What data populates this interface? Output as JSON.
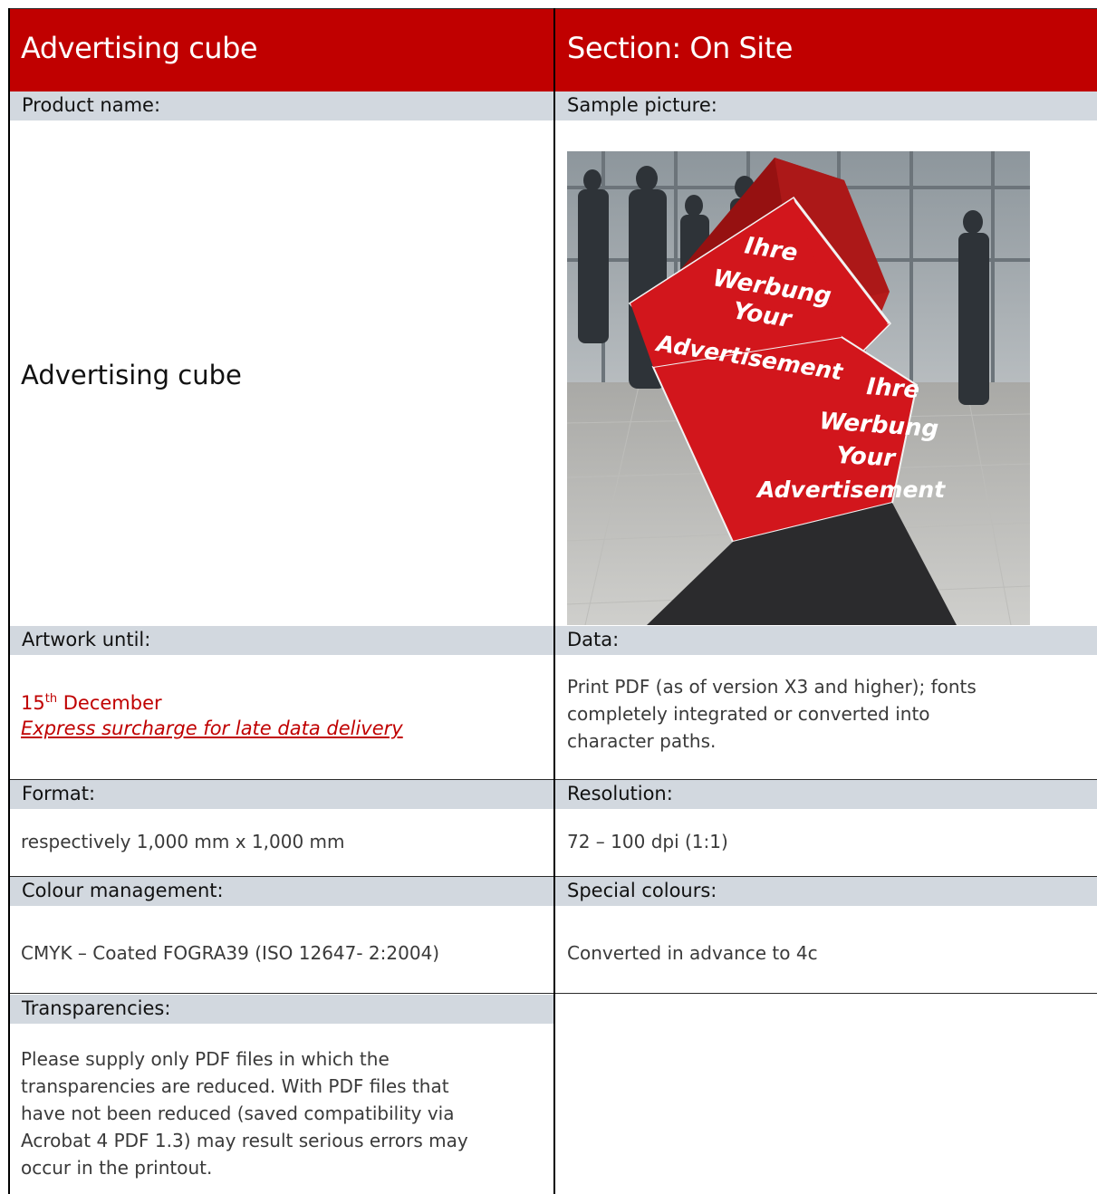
{
  "header": {
    "product_title": "Advertising cube",
    "section_title": "Section: On Site"
  },
  "product": {
    "label": "Product name:",
    "value": "Advertising cube"
  },
  "sample": {
    "label": "Sample picture:",
    "cube_top_text": [
      "Ihre",
      "Werbung",
      "Your",
      "Advertisement"
    ],
    "cube_bottom_text": [
      "Ihre",
      "Werbung",
      "Your",
      "Advertisement"
    ]
  },
  "artwork": {
    "label": "Artwork until:",
    "date_day": "15",
    "date_suffix": "th",
    "date_month": " December",
    "express_note": "Express surcharge for late data delivery"
  },
  "data": {
    "label": "Data:",
    "lines": [
      "Print PDF (as of version X3 and higher); fonts",
      "completely integrated or converted into",
      "character paths."
    ]
  },
  "format": {
    "label": "Format:",
    "value": "respectively 1,000 mm x 1,000 mm"
  },
  "resolution": {
    "label": "Resolution:",
    "value": "72 – 100 dpi (1:1)"
  },
  "colour_management": {
    "label": "Colour management:",
    "value": "CMYK – Coated FOGRA39 (ISO 12647- 2:2004)"
  },
  "special_colours": {
    "label": "Special colours:",
    "value": "Converted in advance to 4c"
  },
  "transparencies": {
    "label": "Transparencies:",
    "lines": [
      "Please supply only PDF files in which the",
      "transparencies are reduced. With PDF files that",
      "have not been reduced (saved compatibility via",
      "Acrobat 4 PDF 1.3) may result serious errors may",
      "occur in the printout."
    ]
  },
  "colors": {
    "brand_red": "#c00000",
    "label_bg": "#d2d8df",
    "text_gray": "#3a3a3a"
  }
}
